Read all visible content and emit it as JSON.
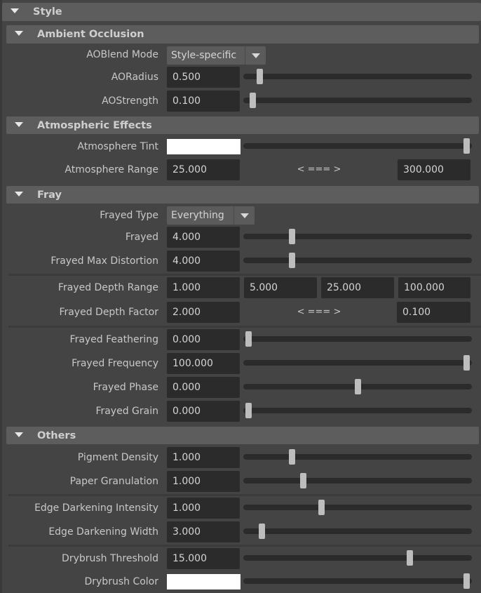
{
  "sections": {
    "style": "Style",
    "ao": "Ambient Occlusion",
    "atmo": "Atmospheric Effects",
    "fray": "Fray",
    "others": "Others"
  },
  "ao": {
    "blend": {
      "label": "AOBlend Mode",
      "value": "Style-specific"
    },
    "radius": {
      "label": "AORadius",
      "value": "0.500",
      "slider": 0.053
    },
    "strength": {
      "label": "AOStrength",
      "value": "0.100",
      "slider": 0.02
    }
  },
  "atmo": {
    "tint": {
      "label": "Atmosphere Tint",
      "color": "#ffffff",
      "slider": 1.0
    },
    "range": {
      "label": "Atmosphere Range",
      "min": "25.000",
      "max": "300.000",
      "arrow": "< === >"
    }
  },
  "fray": {
    "type": {
      "label": "Frayed Type",
      "value": "Everything"
    },
    "frayed": {
      "label": "Frayed",
      "value": "4.000",
      "slider": 0.2
    },
    "maxdist": {
      "label": "Frayed Max Distortion",
      "value": "4.000",
      "slider": 0.2
    },
    "depthrange": {
      "label": "Frayed Depth Range",
      "values": [
        "1.000",
        "5.000",
        "25.000",
        "100.000"
      ]
    },
    "depthfactor": {
      "label": "Frayed Depth Factor",
      "min": "2.000",
      "max": "0.100",
      "arrow": "< === >"
    },
    "feathering": {
      "label": "Frayed Feathering",
      "value": "0.000",
      "slider": 0
    },
    "frequency": {
      "label": "Frayed Frequency",
      "value": "100.000",
      "slider": 1.0
    },
    "phase": {
      "label": "Frayed Phase",
      "value": "0.000",
      "slider": 0.5
    },
    "grain": {
      "label": "Frayed Grain",
      "value": "0.000",
      "slider": 0
    }
  },
  "others": {
    "pigment": {
      "label": "Pigment Density",
      "value": "1.000",
      "slider": 0.2
    },
    "paper": {
      "label": "Paper Granulation",
      "value": "1.000",
      "slider": 0.25
    },
    "edgeint": {
      "label": "Edge Darkening Intensity",
      "value": "1.000",
      "slider": 0.333
    },
    "edgewidth": {
      "label": "Edge Darkening Width",
      "value": "3.000",
      "slider": 0.0625
    },
    "drythr": {
      "label": "Drybrush Threshold",
      "value": "15.000",
      "slider": 0.74
    },
    "drycolor": {
      "label": "Drybrush Color",
      "color": "#ffffff",
      "slider": 1.0
    }
  }
}
